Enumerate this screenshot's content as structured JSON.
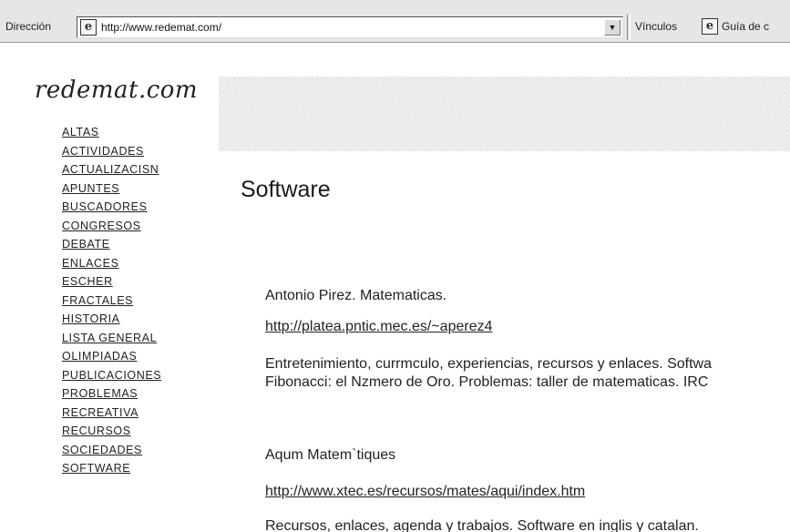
{
  "browser": {
    "address_label": "Dirección",
    "url": "http://www.redemat.com/",
    "links_label": "Vínculos",
    "links_item": "Guía de c"
  },
  "site": {
    "title": "redemat.com"
  },
  "nav": {
    "items": [
      "ALTAS",
      "ACTIVIDADES",
      "ACTUALIZACISN",
      "APUNTES",
      "BUSCADORES",
      "CONGRESOS",
      "DEBATE",
      "ENLACES",
      "ESCHER",
      "FRACTALES",
      "HISTORIA",
      "LISTA GENERAL",
      "OLIMPIADAS",
      "PUBLICACIONES",
      "PROBLEMAS",
      "RECREATIVA",
      "RECURSOS",
      "SOCIEDADES",
      "SOFTWARE"
    ]
  },
  "main": {
    "heading": "Software",
    "entries": [
      {
        "name": "Antonio Pirez. Matematicas.",
        "link": "http://platea.pntic.mec.es/~aperez4",
        "desc_line1": "Entretenimiento, currmculo, experiencias, recursos y enlaces. Softwa",
        "desc_line2": "Fibonacci: el Nzmero de Oro. Problemas: taller de matematicas. IRC"
      },
      {
        "name": "Aqum Matem`tiques",
        "link": "http://www.xtec.es/recursos/mates/aqui/index.htm",
        "desc_line1": "Recursos, enlaces, agenda y trabajos. Software en inglis y catalan."
      }
    ]
  }
}
